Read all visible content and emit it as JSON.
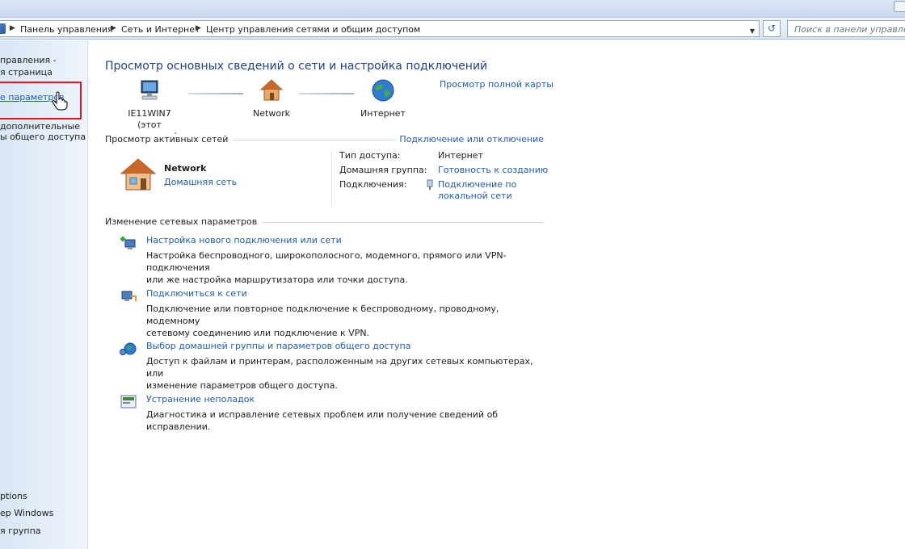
{
  "breadcrumb": {
    "items": [
      "Панель управления",
      "Сеть и Интернет",
      "Центр управления сетями и общим доступом"
    ]
  },
  "search": {
    "placeholder": "Поиск в панели управления"
  },
  "left_pane": {
    "home": [
      "правления -",
      "я страница"
    ],
    "change_adapter": "е параметров",
    "advanced_sharing": [
      "дополнительные",
      "ы общего доступа"
    ],
    "see_also": [
      "ptions",
      "ер Windows",
      "я группа"
    ]
  },
  "main": {
    "title": "Просмотр основных сведений о сети и настройка подключений",
    "full_map_link": "Просмотр полной карты",
    "map": {
      "computer_name": "IE11WIN7",
      "computer_sub": "(этот компьютер)",
      "network": "Network",
      "internet": "Интернет"
    },
    "active_networks_header": "Просмотр активных сетей",
    "connect_disconnect_link": "Подключение или отключение",
    "active_network": {
      "name": "Network",
      "type": "Домашняя сеть",
      "access_type_label": "Тип доступа:",
      "access_type_value": "Интернет",
      "homegroup_label": "Домашняя группа:",
      "homegroup_value": "Готовность к созданию",
      "connections_label": "Подключения:",
      "connections_value_1": "Подключение по",
      "connections_value_2": "локальной сети"
    },
    "change_settings_header": "Изменение сетевых параметров",
    "tasks": [
      {
        "title": "Настройка нового подключения или сети",
        "desc_1": "Настройка беспроводного, широкополосного, модемного, прямого или VPN-подключения",
        "desc_2": "или же настройка маршрутизатора или точки доступа."
      },
      {
        "title": "Подключиться к сети",
        "desc_1": "Подключение или повторное подключение к беспроводному, проводному, модемному",
        "desc_2": "сетевому соединению или подключение к VPN."
      },
      {
        "title": "Выбор домашней группы и параметров общего доступа",
        "desc_1": "Доступ к файлам и принтерам, расположенным на других сетевых компьютерах, или",
        "desc_2": "изменение параметров общего доступа."
      },
      {
        "title": "Устранение неполадок",
        "desc_1": "Диагностика и исправление сетевых проблем или получение сведений об исправлении.",
        "desc_2": ""
      }
    ]
  },
  "colors": {
    "link": "#1e5bb5",
    "title": "#1f3f8a",
    "highlight": "#e3161d"
  },
  "icons": [
    "control-panel-icon",
    "refresh-icon",
    "computer-icon",
    "house-icon",
    "globe-icon",
    "hand-cursor-icon",
    "adapter-icon"
  ]
}
